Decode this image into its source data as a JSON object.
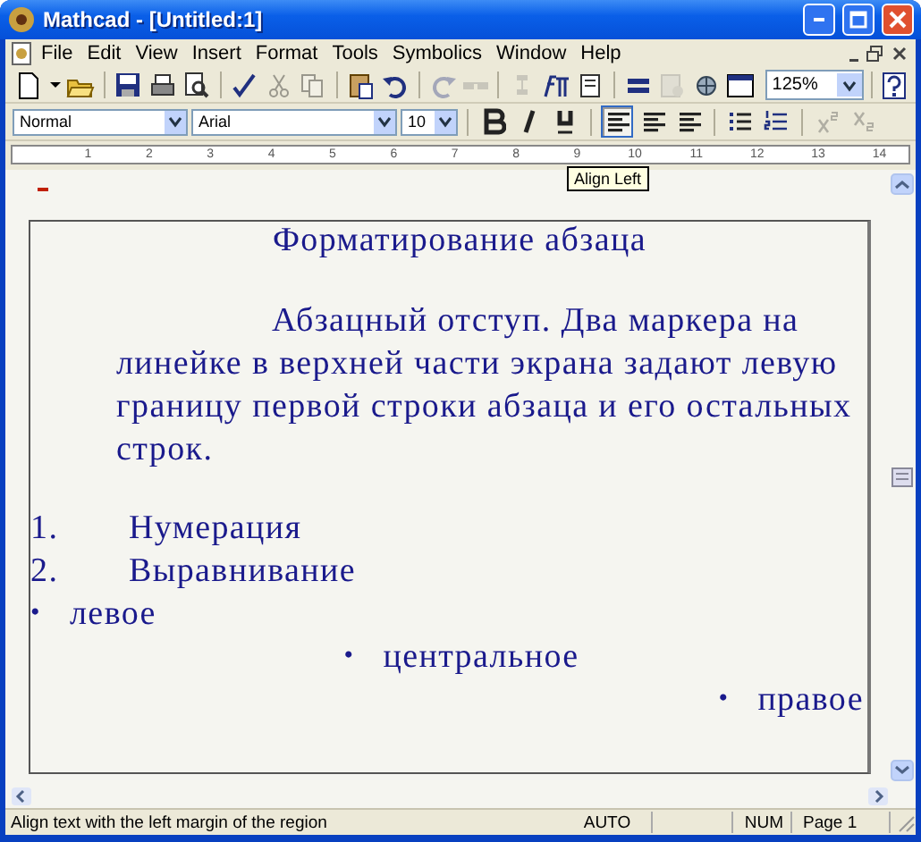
{
  "window": {
    "title": "Mathcad - [Untitled:1]"
  },
  "menu": [
    "File",
    "Edit",
    "View",
    "Insert",
    "Format",
    "Tools",
    "Symbolics",
    "Window",
    "Help"
  ],
  "toolbar": {
    "buttons": [
      {
        "disabled": false
      },
      {
        "disabled": false
      },
      {
        "disabled": false
      },
      {
        "disabled": false
      },
      {
        "disabled": false
      },
      {
        "disabled": false
      },
      {
        "disabled": false
      },
      {
        "disabled": true
      },
      {
        "disabled": true
      },
      {
        "disabled": false
      },
      {
        "disabled": false
      },
      {
        "disabled": true
      },
      {
        "disabled": true
      },
      {
        "disabled": true
      },
      {
        "disabled": false
      },
      {
        "disabled": false
      },
      {
        "disabled": false
      },
      {
        "disabled": true
      },
      {
        "disabled": false
      },
      {
        "disabled": false
      }
    ],
    "zoom": "125%"
  },
  "format_bar": {
    "style": "Normal",
    "font": "Arial",
    "size": "10",
    "align_buttons": [
      {
        "selected": true
      },
      {
        "selected": false
      },
      {
        "selected": false
      }
    ]
  },
  "ruler": {
    "labels": [
      "1",
      "2",
      "3",
      "4",
      "5",
      "6",
      "7",
      "8",
      "9",
      "10",
      "11",
      "12",
      "13",
      "14"
    ]
  },
  "tooltip": "Align Left",
  "document": {
    "heading": "Форматирование абзаца",
    "paragraph": "Абзацный отступ. Два маркера на линейке в верхней части экрана задают левую границу первой строки абзаца и его остальных строк.",
    "list": [
      {
        "marker": "1.",
        "text": "Нумерация",
        "kind": "numbered"
      },
      {
        "marker": "2.",
        "text": "Выравнивание",
        "kind": "numbered"
      },
      {
        "marker": "•",
        "text": "левое",
        "kind": "left"
      },
      {
        "marker": "•",
        "text": "центральное",
        "kind": "center"
      },
      {
        "marker": "•",
        "text": "правое",
        "kind": "right"
      }
    ]
  },
  "status_bar": {
    "message": "Align text with the left margin of the region",
    "mode": "AUTO",
    "num": "NUM",
    "page": "Page 1"
  }
}
